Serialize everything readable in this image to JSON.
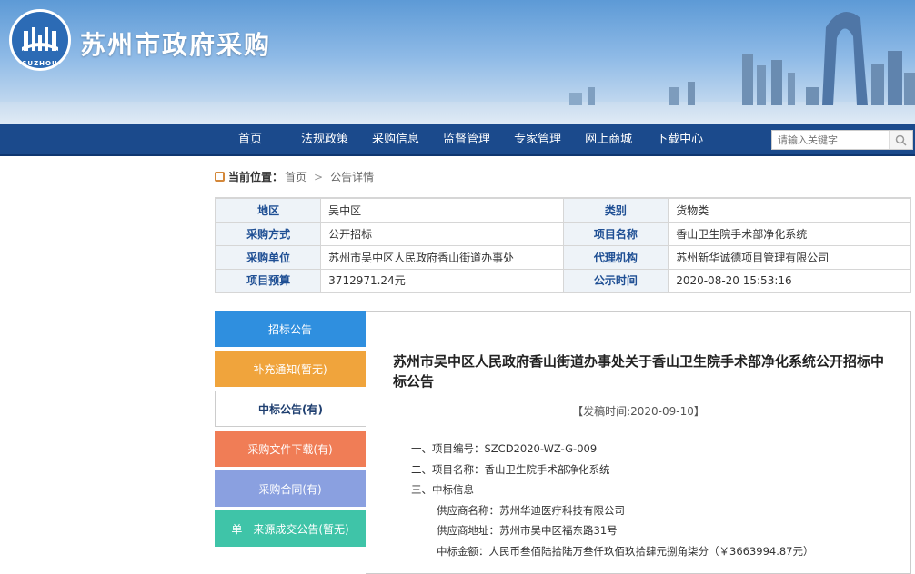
{
  "header": {
    "site_title": "苏州市政府采购",
    "logo_text": "SUZHOU",
    "logo_icon": "suzhou-seal-icon"
  },
  "nav": {
    "items": [
      "首页",
      "法规政策",
      "采购信息",
      "监督管理",
      "专家管理",
      "网上商城",
      "下载中心"
    ],
    "search_placeholder": "请输入关键字",
    "search_icon": "search-icon"
  },
  "breadcrumb": {
    "label": "当前位置：",
    "home": "首页",
    "separator": ">",
    "current": "公告详情"
  },
  "info": {
    "rows": [
      {
        "l1": "地区",
        "v1": "吴中区",
        "l2": "类别",
        "v2": "货物类"
      },
      {
        "l1": "采购方式",
        "v1": "公开招标",
        "l2": "项目名称",
        "v2": "香山卫生院手术部净化系统"
      },
      {
        "l1": "采购单位",
        "v1": "苏州市吴中区人民政府香山街道办事处",
        "l2": "代理机构",
        "v2": "苏州新华诚德项目管理有限公司"
      },
      {
        "l1": "项目预算",
        "v1": "3712971.24元",
        "l2": "公示时间",
        "v2": "2020-08-20 15:53:16"
      }
    ]
  },
  "tabs": [
    {
      "label": "招标公告",
      "color": "#2f8fdf"
    },
    {
      "label": "补充通知(暂无)",
      "color": "#f0a43c"
    },
    {
      "label": "中标公告(有)",
      "color": "#ffffff"
    },
    {
      "label": "采购文件下载(有)",
      "color": "#f07d56"
    },
    {
      "label": "采购合同(有)",
      "color": "#8aa0e0"
    },
    {
      "label": "单一来源成交公告(暂无)",
      "color": "#3fc4a8"
    }
  ],
  "document": {
    "title": "苏州市吴中区人民政府香山街道办事处关于香山卫生院手术部净化系统公开招标中标公告",
    "date": "【发稿时间:2020-09-10】",
    "lines": [
      "一、项目编号：SZCD2020-WZ-G-009",
      "二、项目名称：香山卫生院手术部净化系统",
      "三、中标信息",
      "供应商名称：苏州华迪医疗科技有限公司",
      "供应商地址：苏州市吴中区福东路31号",
      "中标金额：人民币叁佰陆拾陆万叁仟玖佰玖拾肆元捌角柒分（￥3663994.87元）"
    ]
  }
}
